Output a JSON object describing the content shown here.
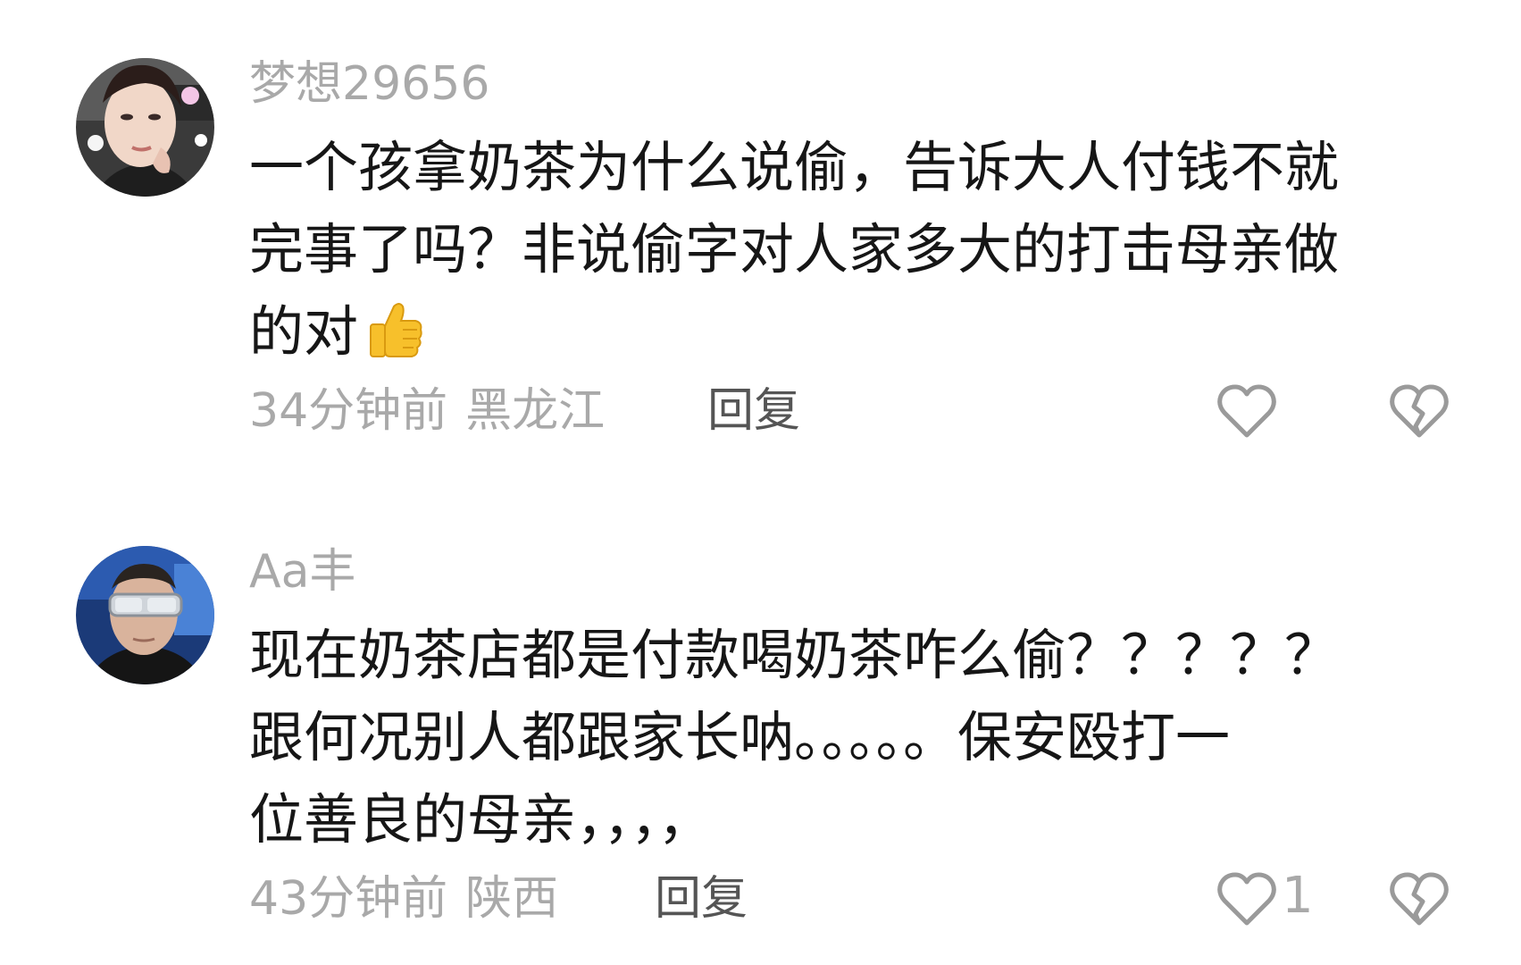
{
  "comments": [
    {
      "username": "梦想29656",
      "lines": [
        "一个孩拿奶茶为什么说偷，告诉大人付钱不就",
        "完事了吗？非说偷字对人家多大的打击母亲做",
        "的对"
      ],
      "emoji": "thumbs-up-emoji",
      "time": "34分钟前",
      "location": "黑龙江",
      "reply_label": "回复",
      "like_count": ""
    },
    {
      "username": "Aa丰",
      "lines": [
        "现在奶茶店都是付款喝奶茶咋么偷？？？？？",
        "跟何况别人都跟家长呐。。。。。保安殴打一",
        "位善良的母亲，，，，"
      ],
      "time": "43分钟前",
      "location": "陕西",
      "reply_label": "回复",
      "like_count": "1"
    }
  ],
  "icons": {
    "like": "heart-outline-icon",
    "dislike": "broken-heart-icon"
  },
  "colors": {
    "muted_text": "#a9a9a9",
    "reply_text": "#555555",
    "body_text": "#161616",
    "icon_gray": "#9a9a9a"
  }
}
